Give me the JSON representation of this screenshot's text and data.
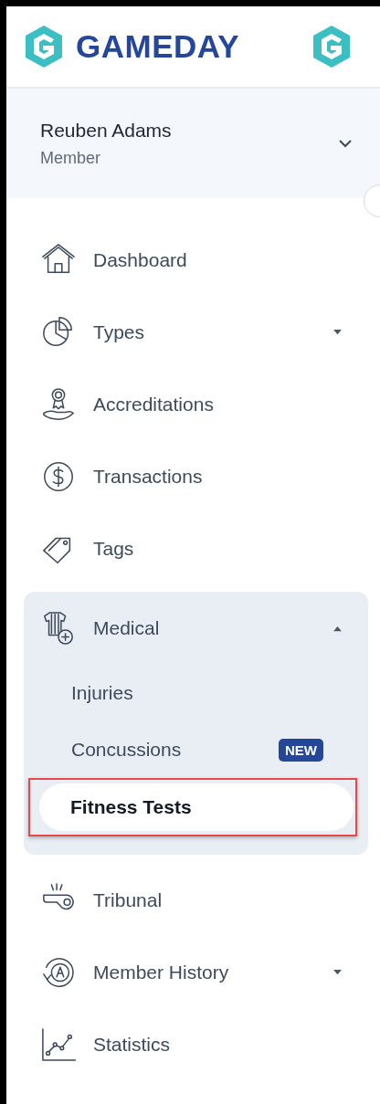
{
  "logo": {
    "text": "GAMEDAY"
  },
  "user": {
    "name": "Reuben Adams",
    "role": "Member",
    "expanded": false
  },
  "nav": [
    {
      "kind": "link",
      "label": "Dashboard"
    },
    {
      "kind": "link",
      "label": "Types",
      "expanded": false
    },
    {
      "kind": "link",
      "label": "Accreditations"
    },
    {
      "kind": "link",
      "label": "Transactions"
    },
    {
      "kind": "link",
      "label": "Tags"
    },
    {
      "kind": "group",
      "label": "Medical",
      "expanded": true,
      "children": [
        {
          "label": "Injuries",
          "selected": false,
          "highlighted": false
        },
        {
          "label": "Concussions",
          "badge": "NEW",
          "selected": false,
          "highlighted": false
        },
        {
          "label": "Fitness Tests",
          "selected": true,
          "highlighted": true
        }
      ]
    },
    {
      "kind": "link",
      "label": "Tribunal"
    },
    {
      "kind": "link",
      "label": "Member History",
      "expanded": false
    },
    {
      "kind": "link",
      "label": "Statistics"
    }
  ]
}
